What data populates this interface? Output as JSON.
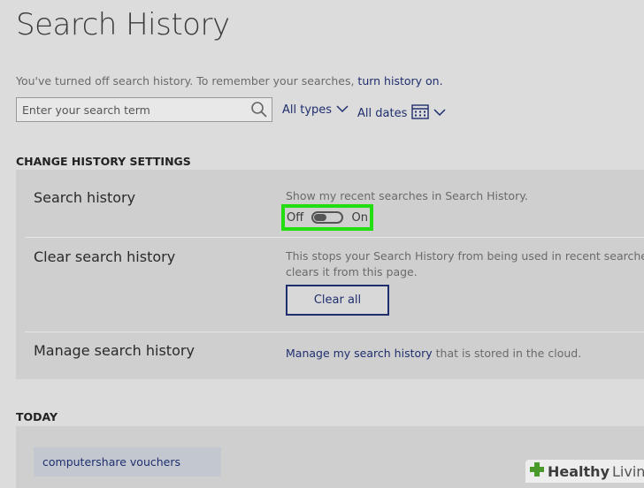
{
  "page": {
    "title": "Search History"
  },
  "notice": {
    "text": "You've turned off search history.  To remember your searches, ",
    "link": "turn history on."
  },
  "search": {
    "placeholder": "Enter your search term"
  },
  "filters": {
    "types_label": "All types",
    "dates_label": "All dates"
  },
  "settings": {
    "heading": "CHANGE HISTORY SETTINGS",
    "rows": [
      {
        "label": "Search history",
        "description": "Show my recent searches in Search History.",
        "toggle_off": "Off",
        "toggle_on": "On",
        "toggle_state": "off"
      },
      {
        "label": "Clear search history",
        "description_line1": "This stops your Search History from being used in recent searches a",
        "description_line2": "clears it from this page.",
        "button": "Clear all"
      },
      {
        "label": "Manage search history",
        "link": "Manage my search history",
        "description_suffix": " that is stored in the cloud."
      }
    ]
  },
  "today": {
    "heading": "TODAY",
    "items": [
      "computershare vouchers"
    ]
  },
  "watermark": {
    "part1": "Healthy",
    "part2": "Living"
  },
  "colors": {
    "accent": "#1f2f6e",
    "highlight": "#22dd10",
    "background": "#dcdcdc",
    "panel": "#cfcfcf"
  }
}
